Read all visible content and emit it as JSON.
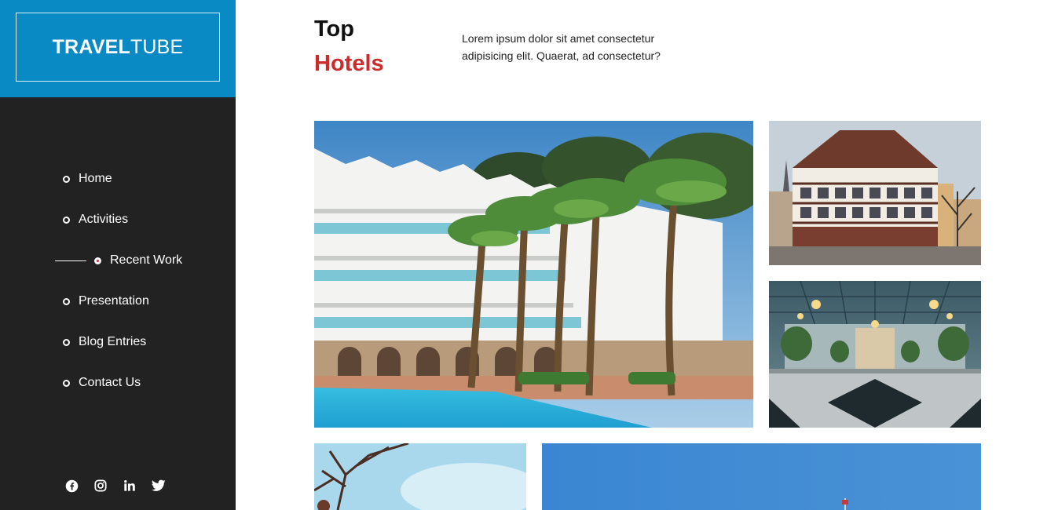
{
  "brand": {
    "bold": "TRAVEL",
    "light": "TUBE"
  },
  "nav": {
    "items": [
      {
        "label": "Home"
      },
      {
        "label": "Activities"
      },
      {
        "label": "Recent Work",
        "active": true
      },
      {
        "label": "Presentation"
      },
      {
        "label": "Blog Entries"
      },
      {
        "label": "Contact Us"
      }
    ]
  },
  "social": [
    "facebook-icon",
    "instagram-icon",
    "linkedin-icon",
    "twitter-icon"
  ],
  "section": {
    "title_top": "Top",
    "title_main": "Hotels",
    "intro": "Lorem ipsum dolor sit amet consectetur adipisicing elit. Quaerat, ad consectetur?"
  },
  "gallery": [
    {
      "name": "resort-pool-photo"
    },
    {
      "name": "timber-hotel-photo"
    },
    {
      "name": "atrium-lobby-photo"
    },
    {
      "name": "tree-sky-photo"
    },
    {
      "name": "blue-sky-photo"
    }
  ],
  "colors": {
    "brand": "#0a8ac4",
    "sidebar": "#222222",
    "accent": "#cc2b2b"
  }
}
